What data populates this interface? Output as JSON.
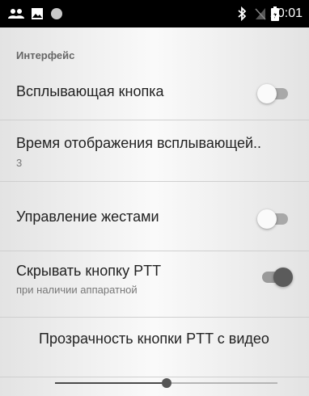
{
  "status_bar": {
    "time": "20:01",
    "left_icons": [
      "people-icon",
      "image-icon",
      "circle-icon"
    ],
    "right_icons": [
      "bluetooth-icon",
      "no-sim-icon",
      "battery-icon"
    ]
  },
  "settings": {
    "section_header": "Интерфейс",
    "popup_button": {
      "title": "Всплывающая кнопка",
      "enabled": false
    },
    "display_time": {
      "title": "Время отображения всплывающей..",
      "value": "3"
    },
    "gestures": {
      "title": "Управление жестами",
      "enabled": false
    },
    "hide_ptt": {
      "title": "Скрывать кнопку PTT",
      "subtitle": "при наличии аппаратной",
      "enabled": true
    },
    "ptt_transparency": {
      "title": "Прозрачность кнопки PTT с видео",
      "level": 0.5
    }
  },
  "colors": {
    "status_bar": "#000000",
    "switch_on_thumb": "#5b5b5b",
    "switch_off_track": "#a8a8a8"
  }
}
